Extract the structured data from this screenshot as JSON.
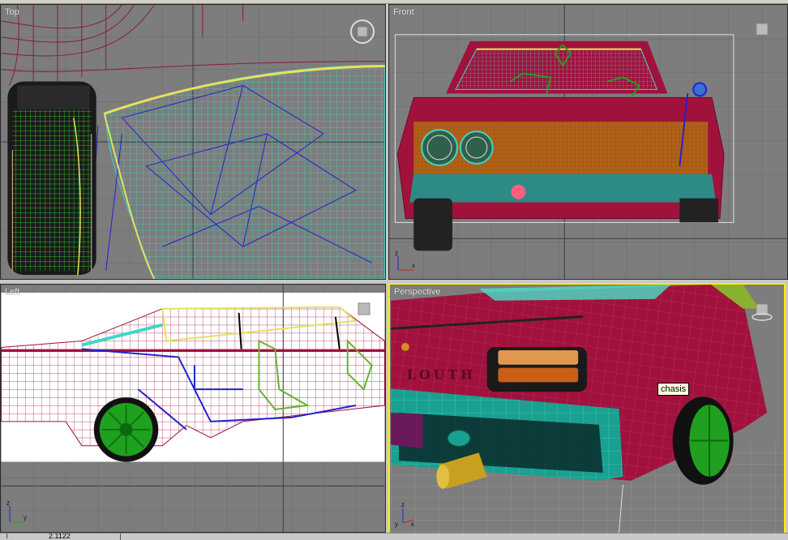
{
  "viewports": {
    "top": {
      "label": "Top"
    },
    "front": {
      "label": "Front"
    },
    "left": {
      "label": "Left"
    },
    "perspective": {
      "label": "Perspective",
      "tooltip": "chasis",
      "decal_text": "LOUTH"
    }
  },
  "axis_labels": {
    "x": "x",
    "y": "y",
    "z": "z"
  },
  "status": {
    "text": "2.1122"
  },
  "colors": {
    "viewport_bg": "#7d7d7d",
    "active_border": "#ffee00",
    "body_wire": "#a0123c",
    "glass_wire": "#40e0c8",
    "tire_green": "#1fa01f",
    "bumper_teal": "#1aa090",
    "exhaust_gold": "#c8a020"
  }
}
